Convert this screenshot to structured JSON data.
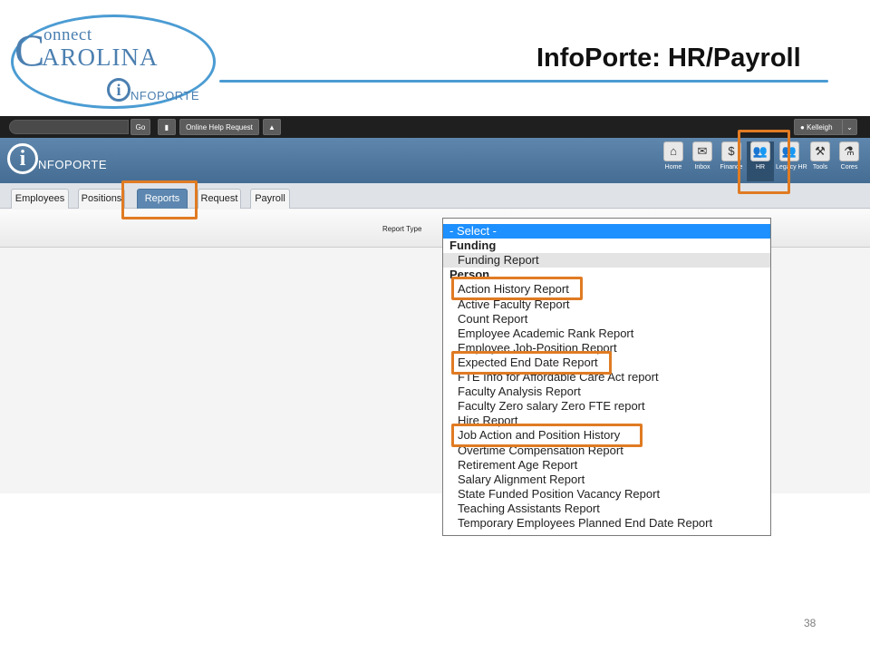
{
  "slide": {
    "title": "InfoPorte: HR/Payroll",
    "page_number": "38"
  },
  "logo": {
    "connect": "onnect",
    "c_letter": "C",
    "carolina": "AROLINA",
    "i_letter": "i",
    "infoporte": "NFOPORTE"
  },
  "topbar": {
    "go_label": "Go",
    "bookmark_icon": "bookmark-icon",
    "help_label": "Online Help Request",
    "bell_icon": "bell-icon",
    "user_label": "Kelleigh",
    "user_icon": "user-icon",
    "caret_icon": "chevron-down-icon"
  },
  "banner": {
    "logo_i": "i",
    "logo_text": "NFOPORTE",
    "modules": [
      {
        "label": "Home",
        "icon": "home-icon",
        "glyph": "⌂"
      },
      {
        "label": "Inbox",
        "icon": "inbox-icon",
        "glyph": "✉"
      },
      {
        "label": "Finance",
        "icon": "dollar-icon",
        "glyph": "$"
      },
      {
        "label": "HR",
        "icon": "people-icon",
        "glyph": "👥"
      },
      {
        "label": "Legacy HR",
        "icon": "legacy-people-icon",
        "glyph": "👥"
      },
      {
        "label": "Tools",
        "icon": "tools-icon",
        "glyph": "⚒"
      },
      {
        "label": "Cores",
        "icon": "flask-icon",
        "glyph": "⚗"
      }
    ]
  },
  "tabs": [
    "Employees",
    "Positions",
    "Reports",
    "Request",
    "Payroll"
  ],
  "filter": {
    "report_type_label": "Report Type"
  },
  "dropdown": {
    "items": [
      {
        "text": "- Select -",
        "kind": "selected"
      },
      {
        "text": "Funding",
        "kind": "group"
      },
      {
        "text": "Funding Report",
        "kind": "hover"
      },
      {
        "text": "Person",
        "kind": "group"
      },
      {
        "text": "Action History Report",
        "kind": "option"
      },
      {
        "text": "Active Faculty Report",
        "kind": "option"
      },
      {
        "text": "Count Report",
        "kind": "option"
      },
      {
        "text": "Employee Academic Rank Report",
        "kind": "option"
      },
      {
        "text": "Employee Job-Position Report",
        "kind": "option"
      },
      {
        "text": "Expected End Date Report",
        "kind": "option"
      },
      {
        "text": "FTE Info for Affordable Care Act report",
        "kind": "option"
      },
      {
        "text": "Faculty Analysis Report",
        "kind": "option"
      },
      {
        "text": "Faculty Zero salary Zero FTE report",
        "kind": "option"
      },
      {
        "text": "Hire Report",
        "kind": "option"
      },
      {
        "text": "Job Action and Position History",
        "kind": "option"
      },
      {
        "text": "Overtime Compensation Report",
        "kind": "option"
      },
      {
        "text": "Retirement Age Report",
        "kind": "option"
      },
      {
        "text": "Salary Alignment Report",
        "kind": "option"
      },
      {
        "text": "State Funded Position Vacancy Report",
        "kind": "option"
      },
      {
        "text": "Teaching Assistants Report",
        "kind": "option"
      },
      {
        "text": "Temporary Employees Planned End Date Report",
        "kind": "option"
      }
    ]
  },
  "colors": {
    "callout": "#e07b23",
    "accent_blue": "#4b9cd3",
    "selected_option": "#1e90ff"
  }
}
